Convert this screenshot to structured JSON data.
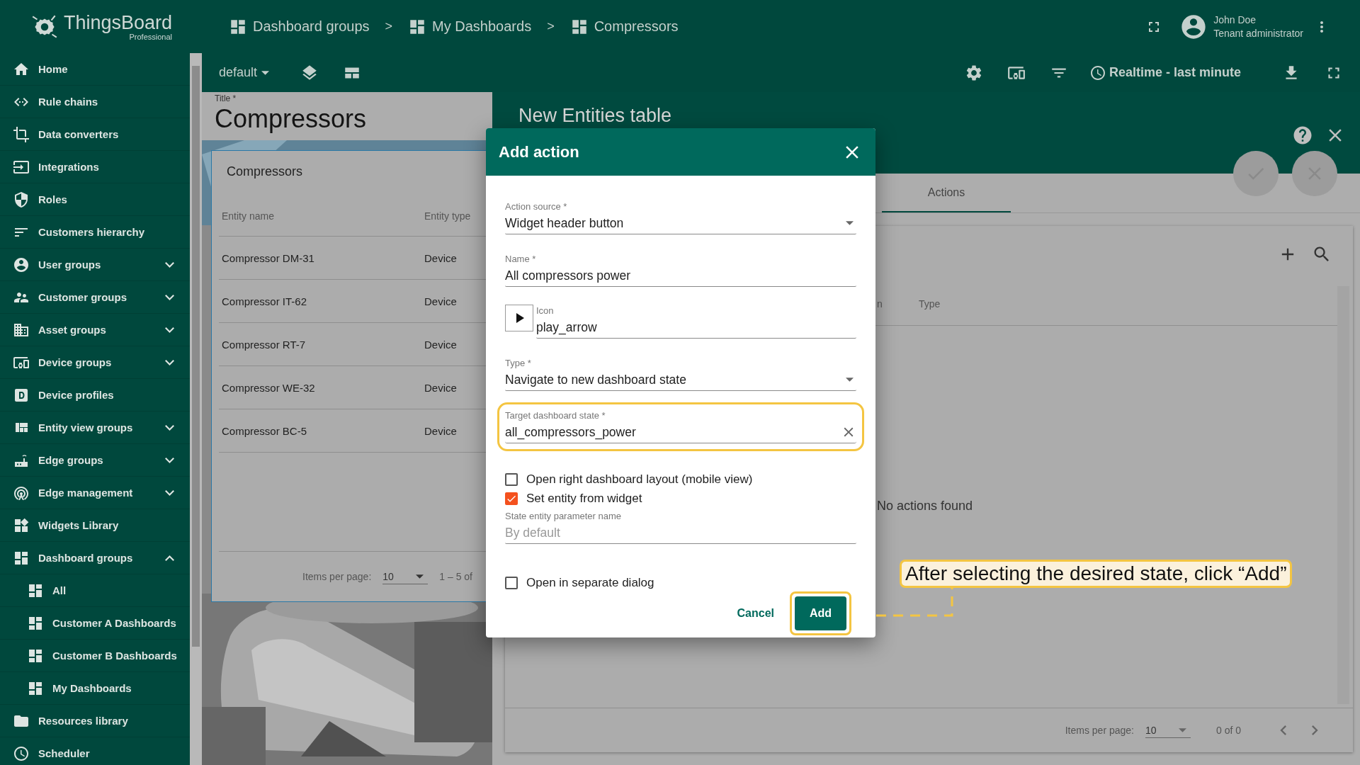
{
  "logo": {
    "name": "ThingsBoard",
    "edition": "Professional"
  },
  "breadcrumbs": {
    "separator": ">",
    "items": [
      "Dashboard groups",
      "My Dashboards",
      "Compressors"
    ]
  },
  "user": {
    "name": "John Doe",
    "role": "Tenant administrator"
  },
  "sidebar": {
    "items": [
      {
        "kind": "link",
        "label": "Home"
      },
      {
        "kind": "link",
        "label": "Rule chains"
      },
      {
        "kind": "link",
        "label": "Data converters"
      },
      {
        "kind": "link",
        "label": "Integrations"
      },
      {
        "kind": "link",
        "label": "Roles"
      },
      {
        "kind": "link",
        "label": "Customers hierarchy"
      },
      {
        "kind": "group",
        "label": "User groups",
        "expanded": false
      },
      {
        "kind": "group",
        "label": "Customer groups",
        "expanded": false
      },
      {
        "kind": "group",
        "label": "Asset groups",
        "expanded": false
      },
      {
        "kind": "group",
        "label": "Device groups",
        "expanded": false
      },
      {
        "kind": "link",
        "label": "Device profiles"
      },
      {
        "kind": "group",
        "label": "Entity view groups",
        "expanded": false
      },
      {
        "kind": "group",
        "label": "Edge groups",
        "expanded": false
      },
      {
        "kind": "group",
        "label": "Edge management",
        "expanded": false
      },
      {
        "kind": "link",
        "label": "Widgets Library"
      },
      {
        "kind": "group",
        "label": "Dashboard groups",
        "expanded": true,
        "children": [
          {
            "label": "All"
          },
          {
            "label": "Customer A Dashboards"
          },
          {
            "label": "Customer B Dashboards"
          },
          {
            "label": "My Dashboards"
          }
        ]
      },
      {
        "kind": "link",
        "label": "Resources library"
      },
      {
        "kind": "link",
        "label": "Scheduler"
      }
    ]
  },
  "toolbar": {
    "state": "default",
    "timewindow": "Realtime - last minute"
  },
  "dashboard": {
    "title_label": "Title *",
    "title": "Compressors",
    "widget": {
      "title": "Compressors",
      "columns": [
        "Entity name",
        "Entity type"
      ],
      "rows": [
        [
          "Compressor DM-31",
          "Device"
        ],
        [
          "Compressor IT-62",
          "Device"
        ],
        [
          "Compressor RT-7",
          "Device"
        ],
        [
          "Compressor WE-32",
          "Device"
        ],
        [
          "Compressor BC-5",
          "Device"
        ]
      ],
      "footer": {
        "items_per_page_label": "Items per page:",
        "page_size": "10",
        "range": "1 – 5 of"
      }
    }
  },
  "panel": {
    "title": "New Entities table",
    "tabs": [
      {
        "label": "Actions",
        "selected": true
      }
    ],
    "columns": [
      "n",
      "Type"
    ],
    "empty_message": "No actions found",
    "footer": {
      "items_per_page_label": "Items per page:",
      "page_size": "10",
      "range": "0 of 0"
    }
  },
  "dialog": {
    "title": "Add action",
    "fields": [
      {
        "kind": "select",
        "label": "Action source *",
        "value": "Widget header button",
        "highlighted": false
      },
      {
        "kind": "text",
        "label": "Name *",
        "value": "All compressors power",
        "highlighted": false
      },
      {
        "kind": "icon",
        "label": "Icon",
        "value": "play_arrow",
        "highlighted": false
      },
      {
        "kind": "select",
        "label": "Type *",
        "value": "Navigate to new dashboard state",
        "highlighted": false
      },
      {
        "kind": "autocomplete",
        "label": "Target dashboard state *",
        "value": "all_compressors_power",
        "highlighted": true
      },
      {
        "kind": "checkbox",
        "label": "Open right dashboard layout (mobile view)",
        "checked": false
      },
      {
        "kind": "checkbox",
        "label": "Set entity from widget",
        "checked": true
      },
      {
        "kind": "text",
        "label": "State entity parameter name",
        "placeholder": "By default",
        "highlighted": false
      },
      {
        "kind": "checkbox",
        "label": "Open in separate dialog",
        "checked": false
      }
    ],
    "buttons": [
      {
        "kind": "text",
        "label": "Cancel",
        "highlighted": false
      },
      {
        "kind": "primary",
        "label": "Add",
        "highlighted": true
      }
    ]
  },
  "callout": {
    "text": "After selecting the desired state, click “Add”"
  }
}
